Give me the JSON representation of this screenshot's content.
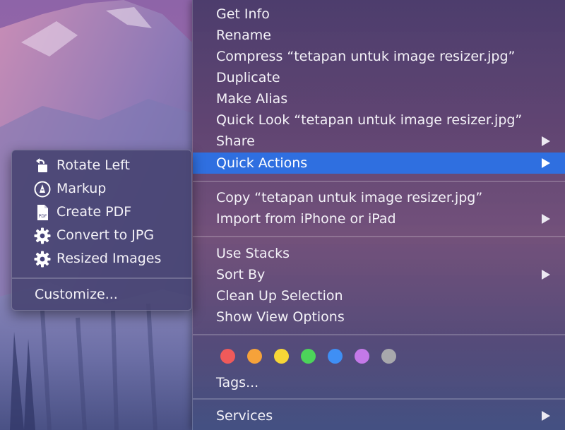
{
  "context_menu": {
    "group1": [
      {
        "label": "Get Info",
        "submenu": false
      },
      {
        "label": "Rename",
        "submenu": false
      },
      {
        "label": "Compress “tetapan untuk image resizer.jpg”",
        "submenu": false
      },
      {
        "label": "Duplicate",
        "submenu": false
      },
      {
        "label": "Make Alias",
        "submenu": false
      },
      {
        "label": "Quick Look “tetapan untuk image resizer.jpg”",
        "submenu": false
      },
      {
        "label": "Share",
        "submenu": true
      },
      {
        "label": "Quick Actions",
        "submenu": true,
        "highlighted": true
      }
    ],
    "group2": [
      {
        "label": "Copy “tetapan untuk image resizer.jpg”",
        "submenu": false
      },
      {
        "label": "Import from iPhone or iPad",
        "submenu": true
      }
    ],
    "group3": [
      {
        "label": "Use Stacks",
        "submenu": false
      },
      {
        "label": "Sort By",
        "submenu": true
      },
      {
        "label": "Clean Up Selection",
        "submenu": false
      },
      {
        "label": "Show View Options",
        "submenu": false
      }
    ],
    "tags": {
      "colors": [
        {
          "name": "red",
          "hex": "#f05a5a"
        },
        {
          "name": "orange",
          "hex": "#f6a23a"
        },
        {
          "name": "yellow",
          "hex": "#f7d637"
        },
        {
          "name": "green",
          "hex": "#4cd45a"
        },
        {
          "name": "blue",
          "hex": "#3f8ff5"
        },
        {
          "name": "purple",
          "hex": "#c479e8"
        },
        {
          "name": "gray",
          "hex": "#a8a8ac"
        }
      ],
      "label": "Tags..."
    },
    "services": {
      "label": "Services",
      "submenu": true
    },
    "highlight_color": "#2f6fe0"
  },
  "quick_actions_submenu": {
    "items": [
      {
        "label": "Rotate Left",
        "icon": "rotate-left-icon"
      },
      {
        "label": "Markup",
        "icon": "markup-icon"
      },
      {
        "label": "Create PDF",
        "icon": "pdf-icon"
      },
      {
        "label": "Convert to JPG",
        "icon": "gear-icon"
      },
      {
        "label": "Resized Images",
        "icon": "gear-icon"
      }
    ],
    "customize_label": "Customize..."
  }
}
